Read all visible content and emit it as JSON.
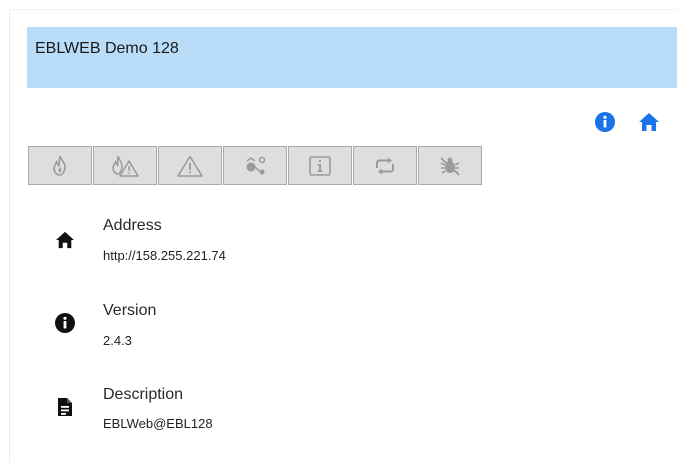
{
  "header": {
    "title": "EBLWEB Demo 128"
  },
  "top_icons": [
    {
      "name": "info-circle-icon",
      "color": "#1a73e8"
    },
    {
      "name": "home-icon",
      "color": "#1a73e8"
    }
  ],
  "toolbar": {
    "buttons": [
      {
        "name": "fire-icon"
      },
      {
        "name": "fire-warning-icon"
      },
      {
        "name": "warning-triangle-icon"
      },
      {
        "name": "device-connect-icon"
      },
      {
        "name": "info-box-icon"
      },
      {
        "name": "refresh-loop-icon"
      },
      {
        "name": "bug-disabled-icon"
      }
    ]
  },
  "details": [
    {
      "icon": "home-icon",
      "label": "Address",
      "value": "http://158.255.221.74"
    },
    {
      "icon": "info-circle-icon",
      "label": "Version",
      "value": "2.4.3"
    },
    {
      "icon": "document-icon",
      "label": "Description",
      "value": "EBLWeb@EBL128"
    }
  ],
  "colors": {
    "header_bg": "#b9dcf8",
    "accent": "#1a73e8",
    "button_bg": "#dedede",
    "button_border": "#a9a9a9"
  }
}
